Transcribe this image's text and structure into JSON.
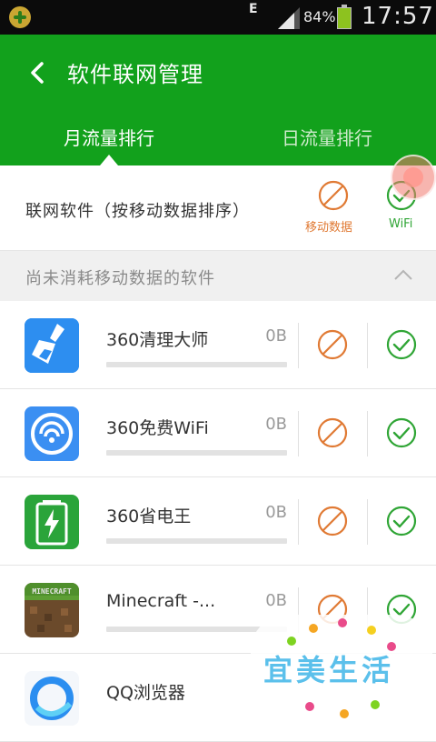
{
  "status_bar": {
    "network_type": "E",
    "battery_percent": "84%",
    "time": "17:57"
  },
  "header": {
    "title": "软件联网管理"
  },
  "tabs": [
    {
      "label": "月流量排行",
      "active": true
    },
    {
      "label": "日流量排行",
      "active": false
    }
  ],
  "column_header": {
    "label": "联网软件（按移动数据排序）",
    "mobile_label": "移动数据",
    "wifi_label": "WiFi"
  },
  "section": {
    "label": "尚未消耗移动数据的软件"
  },
  "apps": [
    {
      "name": "360清理大师",
      "usage": "0B",
      "icon": "broom-icon",
      "mobile_allowed": false,
      "wifi_allowed": true
    },
    {
      "name": "360免费WiFi",
      "usage": "0B",
      "icon": "wifi-app-icon",
      "mobile_allowed": false,
      "wifi_allowed": true
    },
    {
      "name": "360省电王",
      "usage": "0B",
      "icon": "battery-app-icon",
      "mobile_allowed": false,
      "wifi_allowed": true
    },
    {
      "name": "Minecraft -...",
      "usage": "0B",
      "icon": "minecraft-icon",
      "mobile_allowed": false,
      "wifi_allowed": true
    },
    {
      "name": "QQ浏览器",
      "usage": "",
      "icon": "qq-browser-icon",
      "mobile_allowed": false,
      "wifi_allowed": true
    }
  ],
  "minecraft_logo_text": "MINECRAFT",
  "watermark": {
    "text": "宜美生活"
  },
  "colors": {
    "brand_green": "#12a11c",
    "mobile_orange": "#e07a34",
    "wifi_green": "#2fa535"
  }
}
